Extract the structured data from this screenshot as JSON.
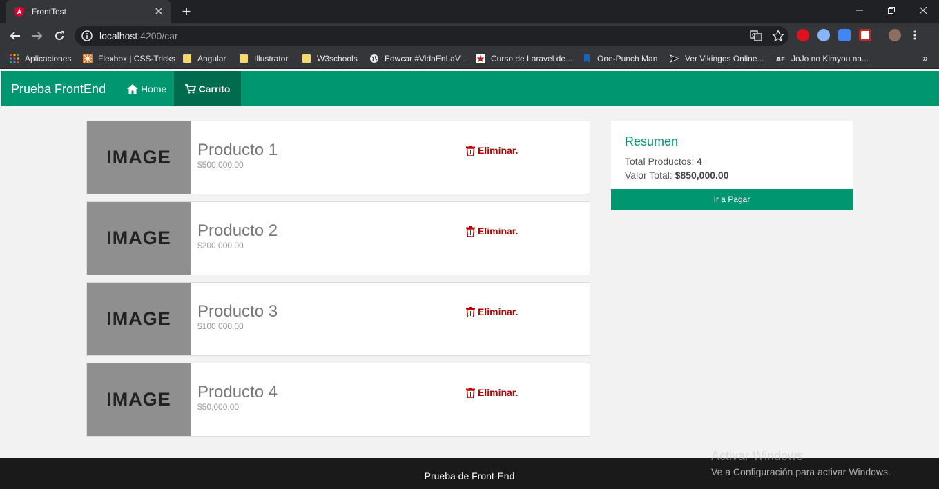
{
  "browser": {
    "tab_title": "FrontTest",
    "url_host": "localhost",
    "url_path": ":4200/car",
    "bookmarks": [
      {
        "label": "Aplicaciones",
        "icon": "apps-grid-icon"
      },
      {
        "label": "Flexbox | CSS-Tricks",
        "icon": "css-tricks-icon"
      },
      {
        "label": "Angular",
        "icon": "folder-icon"
      },
      {
        "label": "Illustrator",
        "icon": "folder-icon"
      },
      {
        "label": "W3schools",
        "icon": "folder-icon"
      },
      {
        "label": "Edwcar #VidaEnLaV...",
        "icon": "globe-icon"
      },
      {
        "label": "Curso de Laravel de...",
        "icon": "star-logo-icon"
      },
      {
        "label": "One-Punch Man",
        "icon": "bookmark-icon"
      },
      {
        "label": "Ver Vikingos Online...",
        "icon": "pen-icon"
      },
      {
        "label": "JoJo no Kimyou na...",
        "icon": "af-icon"
      }
    ]
  },
  "navbar": {
    "brand": "Prueba FrontEnd",
    "home": "Home",
    "cart": "Carrito"
  },
  "products": [
    {
      "image_text": "IMAGE",
      "name": "Producto 1",
      "price": "$500,000.00",
      "remove": "Eliminar."
    },
    {
      "image_text": "IMAGE",
      "name": "Producto 2",
      "price": "$200,000.00",
      "remove": "Eliminar."
    },
    {
      "image_text": "IMAGE",
      "name": "Producto 3",
      "price": "$100,000.00",
      "remove": "Eliminar."
    },
    {
      "image_text": "IMAGE",
      "name": "Producto 4",
      "price": "$50,000.00",
      "remove": "Eliminar."
    }
  ],
  "summary": {
    "title": "Resumen",
    "total_products_label": "Total Productos:",
    "total_products_value": "4",
    "total_value_label": "Valor Total:",
    "total_value_value": "$850,000.00",
    "pay_button": "Ir a Pagar"
  },
  "footer": {
    "text": "Prueba de Front-End"
  },
  "watermark": {
    "title": "Activar Windows",
    "subtitle": "Ve a Configuración para activar Windows."
  },
  "colors": {
    "brand_green": "#009670",
    "active_nav": "#006b4f",
    "danger": "#c00000"
  }
}
